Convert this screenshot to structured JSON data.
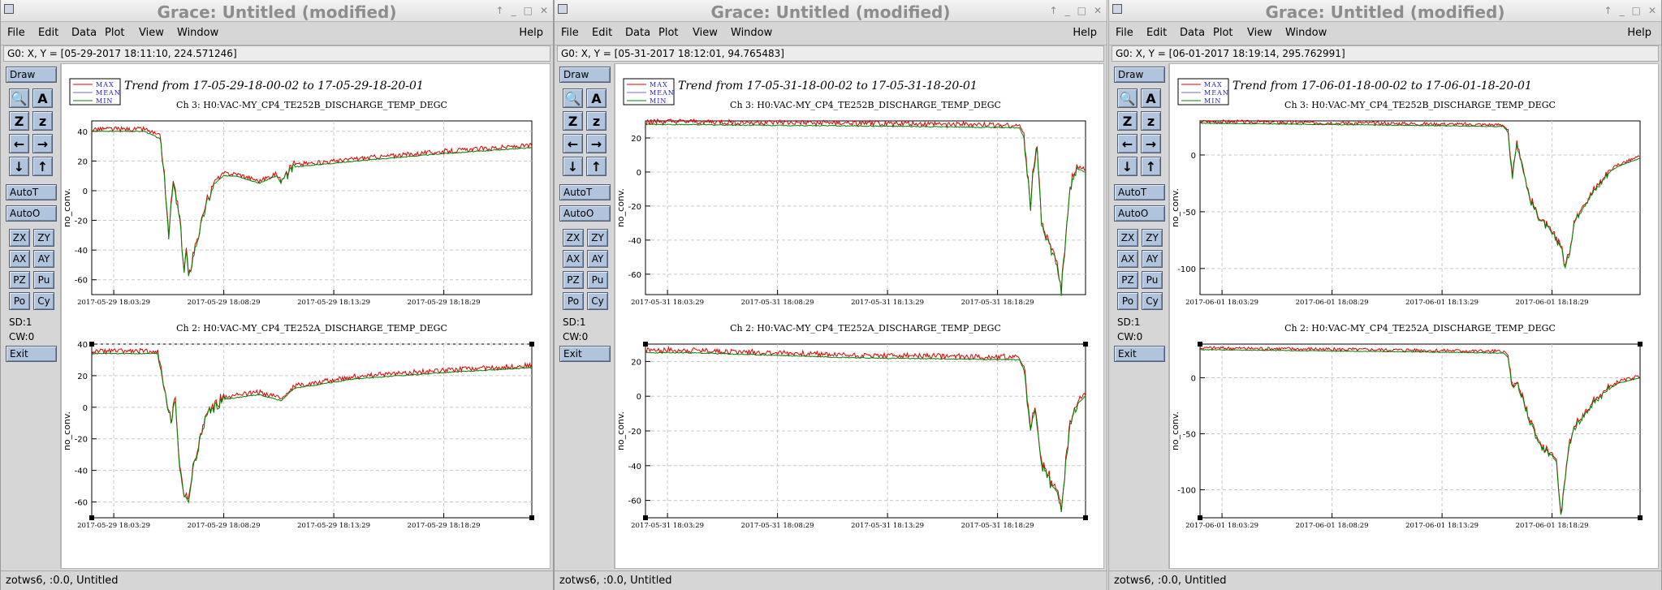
{
  "windows": [
    {
      "title": "Grace: Untitled (modified)",
      "locator": "G0: X, Y = [05-29-2017 18:11:10, 224.571246]",
      "status": "zotws6, :0.0, Untitled",
      "trend_title": "Trend from 17-05-29-18-00-02 to 17-05-29-18-20-01",
      "graphs": [
        {
          "title": "Ch 3: H0:VAC-MY_CP4_TE252B_DISCHARGE_TEMP_DEGC",
          "ylabel": "no_conv.",
          "yticks": [
            "40",
            "20",
            "0",
            "-20",
            "-40",
            "-60"
          ],
          "xticks": [
            "2017-05-29 18:03:29",
            "2017-05-29 18:08:29",
            "2017-05-29 18:13:29",
            "2017-05-29 18:18:29"
          ]
        },
        {
          "title": "Ch 2: H0:VAC-MY_CP4_TE252A_DISCHARGE_TEMP_DEGC",
          "ylabel": "no_conv.",
          "yticks": [
            "40",
            "20",
            "0",
            "-20",
            "-40",
            "-60"
          ],
          "xticks": [
            "2017-05-29 18:03:29",
            "2017-05-29 18:08:29",
            "2017-05-29 18:13:29",
            "2017-05-29 18:18:29"
          ]
        }
      ]
    },
    {
      "title": "Grace: Untitled (modified)",
      "locator": "G0: X, Y = [05-31-2017 18:12:01, 94.765483]",
      "status": "zotws6, :0.0, Untitled",
      "trend_title": "Trend from 17-05-31-18-00-02 to 17-05-31-18-20-01",
      "graphs": [
        {
          "title": "Ch 3: H0:VAC-MY_CP4_TE252B_DISCHARGE_TEMP_DEGC",
          "ylabel": "no_conv.",
          "yticks": [
            "20",
            "0",
            "-20",
            "-40",
            "-60"
          ],
          "xticks": [
            "2017-05-31 18:03:29",
            "2017-05-31 18:08:29",
            "2017-05-31 18:13:29",
            "2017-05-31 18:18:29"
          ]
        },
        {
          "title": "Ch 2: H0:VAC-MY_CP4_TE252A_DISCHARGE_TEMP_DEGC",
          "ylabel": "no_conv.",
          "yticks": [
            "20",
            "0",
            "-20",
            "-40",
            "-60"
          ],
          "xticks": [
            "2017-05-31 18:03:29",
            "2017-05-31 18:08:29",
            "2017-05-31 18:13:29",
            "2017-05-31 18:18:29"
          ]
        }
      ]
    },
    {
      "title": "Grace: Untitled (modified)",
      "locator": "G0: X, Y = [06-01-2017 18:19:14, 295.762991]",
      "status": "zotws6, :0.0, Untitled",
      "trend_title": "Trend from 17-06-01-18-00-02 to 17-06-01-18-20-01",
      "graphs": [
        {
          "title": "Ch 3: H0:VAC-MY_CP4_TE252B_DISCHARGE_TEMP_DEGC",
          "ylabel": "no_conv.",
          "yticks": [
            "0",
            "-50",
            "-100"
          ],
          "xticks": [
            "2017-06-01 18:03:29",
            "2017-06-01 18:08:29",
            "2017-06-01 18:13:29",
            "2017-06-01 18:18:29"
          ]
        },
        {
          "title": "Ch 2: H0:VAC-MY_CP4_TE252A_DISCHARGE_TEMP_DEGC",
          "ylabel": "no_conv.",
          "yticks": [
            "0",
            "-50",
            "-100"
          ],
          "xticks": [
            "2017-06-01 18:03:29",
            "2017-06-01 18:08:29",
            "2017-06-01 18:13:29",
            "2017-06-01 18:18:29"
          ]
        }
      ]
    }
  ],
  "menu": {
    "items": [
      "File",
      "Edit",
      "Data",
      "Plot",
      "View",
      "Window"
    ],
    "help": "Help"
  },
  "toolbar": {
    "draw": "Draw",
    "icons": [
      "magnifier-icon",
      "autoscale-icon",
      "zoom-in-icon",
      "zoom-out-icon",
      "arrow-left-icon",
      "arrow-right-icon",
      "arrow-down-icon",
      "arrow-up-icon"
    ],
    "icon_glyphs": [
      "🔍",
      "A",
      "Z",
      "z",
      "←",
      "→",
      "↓",
      "↑"
    ],
    "autot": "AutoT",
    "autoo": "AutoO",
    "pairs": [
      [
        "ZX",
        "ZY"
      ],
      [
        "AX",
        "AY"
      ],
      [
        "PZ",
        "Pu"
      ],
      [
        "Po",
        "Cy"
      ]
    ],
    "sd": "SD:1",
    "cw": "CW:0",
    "exit": "Exit"
  },
  "legend": {
    "max": "MAX",
    "mean": "MEAN",
    "min": "MIN"
  },
  "colors": {
    "max": "#e00000",
    "mean": "#6b6bd6",
    "min": "#008000",
    "button_face": "#b0c4de",
    "grid": "#c8c8c8"
  },
  "chart_data": [
    {
      "type": "line",
      "title": "Ch 3: H0:VAC-MY_CP4_TE252B_DISCHARGE_TEMP_DEGC",
      "ylabel": "no_conv.",
      "ylim": [
        -70,
        47
      ],
      "x": [
        0,
        0.12,
        0.155,
        0.165,
        0.175,
        0.185,
        0.2,
        0.21,
        0.215,
        0.22,
        0.23,
        0.26,
        0.28,
        0.3,
        0.33,
        0.38,
        0.42,
        0.43,
        0.46,
        0.6,
        0.8,
        1.0
      ],
      "series": [
        {
          "name": "MIN",
          "values": [
            40,
            40,
            35,
            10,
            -30,
            5,
            -20,
            -55,
            -40,
            -60,
            -45,
            -10,
            5,
            10,
            10,
            5,
            10,
            5,
            16,
            20,
            25,
            29
          ]
        }
      ]
    },
    {
      "type": "line",
      "title": "Ch 2: H0:VAC-MY_CP4_TE252A_DISCHARGE_TEMP_DEGC",
      "ylabel": "no_conv.",
      "ylim": [
        -70,
        40
      ],
      "x": [
        0,
        0.15,
        0.16,
        0.18,
        0.19,
        0.2,
        0.21,
        0.22,
        0.23,
        0.26,
        0.3,
        0.38,
        0.42,
        0.43,
        0.46,
        0.6,
        0.8,
        1.0
      ],
      "series": [
        {
          "name": "MIN",
          "values": [
            34,
            34,
            20,
            -10,
            5,
            -40,
            -55,
            -60,
            -40,
            -5,
            5,
            8,
            5,
            4,
            12,
            18,
            22,
            25
          ]
        }
      ]
    },
    {
      "type": "line",
      "title": "Ch 3: H0:VAC-MY_CP4_TE252B_DISCHARGE_TEMP_DEGC",
      "ylabel": "no_conv.",
      "ylim": [
        -72,
        30
      ],
      "x": [
        0,
        0.5,
        0.85,
        0.86,
        0.875,
        0.88,
        0.89,
        0.9,
        0.92,
        0.935,
        0.945,
        0.955,
        0.965,
        0.98,
        1.0
      ],
      "series": [
        {
          "name": "MIN",
          "values": [
            28,
            27,
            26,
            20,
            -20,
            0,
            15,
            -30,
            -45,
            -55,
            -70,
            -40,
            -10,
            2,
            0
          ]
        }
      ]
    },
    {
      "type": "line",
      "title": "Ch 2: H0:VAC-MY_CP4_TE252A_DISCHARGE_TEMP_DEGC",
      "ylabel": "no_conv.",
      "ylim": [
        -70,
        30
      ],
      "x": [
        0,
        0.1,
        0.5,
        0.85,
        0.86,
        0.875,
        0.885,
        0.9,
        0.92,
        0.935,
        0.945,
        0.955,
        0.965,
        0.98,
        1.0
      ],
      "series": [
        {
          "name": "MIN",
          "values": [
            25,
            25,
            22,
            21,
            15,
            -20,
            -5,
            -40,
            -50,
            -55,
            -65,
            -40,
            -15,
            -5,
            0
          ]
        }
      ]
    },
    {
      "type": "line",
      "title": "Ch 3: H0:VAC-MY_CP4_TE252B_DISCHARGE_TEMP_DEGC",
      "ylabel": "no_conv.",
      "ylim": [
        -123,
        30
      ],
      "x": [
        0,
        0.5,
        0.69,
        0.7,
        0.71,
        0.72,
        0.73,
        0.75,
        0.77,
        0.8,
        0.82,
        0.83,
        0.84,
        0.85,
        0.87,
        0.9,
        0.93,
        0.95,
        1.0
      ],
      "series": [
        {
          "name": "MIN",
          "values": [
            28,
            26,
            25,
            20,
            -20,
            10,
            -5,
            -40,
            -55,
            -70,
            -80,
            -100,
            -85,
            -60,
            -45,
            -30,
            -15,
            -10,
            -3
          ]
        }
      ]
    },
    {
      "type": "line",
      "title": "Ch 2: H0:VAC-MY_CP4_TE252A_DISCHARGE_TEMP_DEGC",
      "ylabel": "no_conv.",
      "ylim": [
        -125,
        30
      ],
      "x": [
        0,
        0.5,
        0.69,
        0.7,
        0.71,
        0.72,
        0.73,
        0.75,
        0.77,
        0.8,
        0.81,
        0.82,
        0.83,
        0.84,
        0.85,
        0.87,
        0.9,
        0.93,
        0.95,
        1.0
      ],
      "series": [
        {
          "name": "MIN",
          "values": [
            25,
            23,
            22,
            18,
            -10,
            -5,
            -15,
            -40,
            -60,
            -70,
            -75,
            -125,
            -90,
            -60,
            -45,
            -35,
            -20,
            -10,
            -5,
            0
          ]
        }
      ]
    }
  ]
}
